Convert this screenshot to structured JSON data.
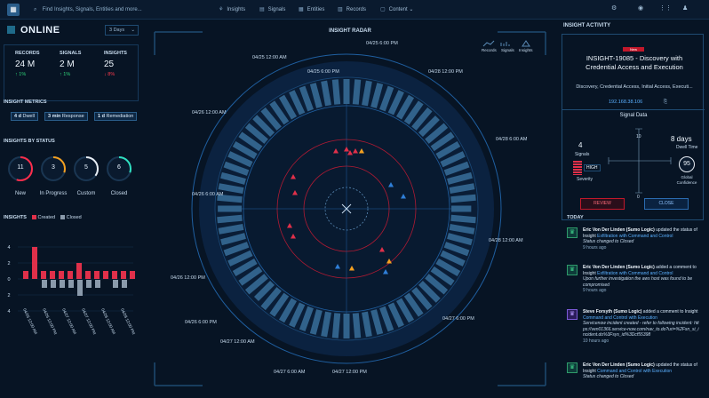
{
  "topbar": {
    "search_placeholder": "Find Insights, Signals, Entities and more...",
    "nav": [
      "Insights",
      "Signals",
      "Entities",
      "Records",
      "Content"
    ]
  },
  "left": {
    "status": "ONLINE",
    "days": "3 Days",
    "stats": [
      {
        "label": "RECORDS",
        "value": "24 M",
        "change": "↑ 1%",
        "color": "#2fd47a"
      },
      {
        "label": "SIGNALS",
        "value": "2 M",
        "change": "↑ 1%",
        "color": "#2fd47a"
      },
      {
        "label": "INSIGHTS",
        "value": "25",
        "change": "↓ 8%",
        "color": "#ff3b4e"
      }
    ],
    "metrics_title": "INSIGHT METRICS",
    "metrics": [
      {
        "value": "4 d",
        "label": "Dwell"
      },
      {
        "value": "3 min",
        "label": "Response"
      },
      {
        "value": "1 d",
        "label": "Remediation"
      }
    ],
    "status_title": "INSIGHTS BY STATUS",
    "gauges": [
      {
        "label": "New",
        "value": "11",
        "fraction": 0.55,
        "color": "#ff2d4b"
      },
      {
        "label": "In Progress",
        "value": "3",
        "fraction": 0.3,
        "color": "#f4a020"
      },
      {
        "label": "Custom",
        "value": "5",
        "fraction": 0.35,
        "color": "#e8eef5"
      },
      {
        "label": "Closed",
        "value": "6",
        "fraction": 0.3,
        "color": "#2fe0c0"
      }
    ],
    "insights_chart": {
      "title": "INSIGHTS",
      "legend_created": "Created",
      "legend_closed": "Closed",
      "y_ticks": [
        "4",
        "2",
        "0",
        "2",
        "4"
      ],
      "x_labels": [
        "04/26 12:00 AM",
        "04/26 12:00 PM",
        "04/27 12:00 AM",
        "04/27 12:00 PM",
        "04/28 12:00 AM",
        "04/28 12:00 PM"
      ],
      "created": [
        1,
        4,
        1,
        1,
        1,
        1,
        2,
        1,
        1,
        1,
        1,
        1,
        1
      ],
      "closed": [
        0,
        0,
        1,
        1,
        1,
        1,
        2,
        1,
        1,
        0,
        1,
        1,
        0
      ]
    }
  },
  "radar": {
    "title": "INSIGHT RADAR",
    "legend": [
      "Records",
      "Signals",
      "Insights"
    ],
    "time_labels": [
      "04/25 6:00 PM",
      "04/25 12:00 AM",
      "04/25 6:00 PM",
      "04/26 12:00 AM",
      "04/26 6:00 AM",
      "04/26 12:00 PM",
      "04/26 6:00 PM",
      "04/27 12:00 AM",
      "04/27 6:00 AM",
      "04/27 12:00 PM",
      "04/27 6:00 PM",
      "04/28 12:00 AM",
      "04/28 6:00 AM",
      "04/28 12:00 PM"
    ]
  },
  "right": {
    "title": "INSIGHT ACTIVITY",
    "severity_tag": "New",
    "insight_title": "INSIGHT-19085 - Discovery with Credential Access and Execution",
    "tags": "Discovery, Credential Access, Initial Access, Executi...",
    "ip": "192.168.38.106",
    "signal_data_title": "Signal Data",
    "signals_count": "4",
    "signals_label": "Signals",
    "severity_value": "HIGH",
    "severity_label": "Severity",
    "dwell_value": "8 days",
    "dwell_label": "Dwell Time",
    "confidence_value": "95",
    "confidence_label": "Global Confidence",
    "axis_top": "10",
    "axis_bottom": "0",
    "review_btn": "REVIEW",
    "close_btn": "CLOSE",
    "today_label": "TODAY",
    "feed": [
      {
        "actor": "Eric Von Der Linden (Sumo Logic)",
        "action": "updated the status of Insight",
        "target": "Exfiltration with Command and Control",
        "note": "Status changed to Closed",
        "time": "9 hours ago"
      },
      {
        "actor": "Eric Von Der Linden (Sumo Logic)",
        "action": "added a comment to Insight",
        "target": "Exfiltration with Command and Control",
        "note": "Upon further investigation the aws host was found to be compromised",
        "time": "9 hours ago"
      },
      {
        "actor": "Steve Forsyth (Sumo Logic)",
        "action": "added a comment to Insight",
        "target": "Command and Control with Execution",
        "note": "Servicenow incident created - refer to following incident: https://ven01366.service-now.com/nav_to.do?uri=%2Fsn_si_incident.do%3Fsys_id%3Dcf55398",
        "time": "10 hours ago"
      },
      {
        "actor": "Eric Von Der Linden (Sumo Logic)",
        "action": "updated the status of Insight",
        "target": "Command and Control with Execution",
        "note": "Status changed to Closed",
        "time": ""
      }
    ]
  }
}
